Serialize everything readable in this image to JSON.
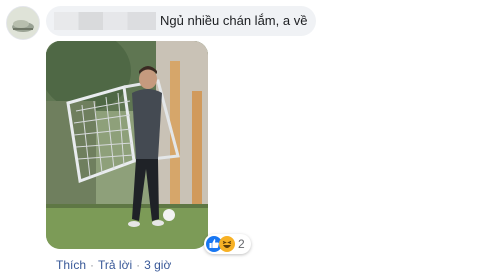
{
  "comment": {
    "author_name": "",
    "text": "Ngủ nhiều chán lắm, a về",
    "reactions": {
      "icons": [
        "like-icon",
        "haha-icon"
      ],
      "count": "2"
    },
    "actions": {
      "like": "Thích",
      "reply": "Trả lời",
      "time": "3 giờ",
      "separator": "·"
    }
  },
  "colors": {
    "bubble": "#f0f2f5",
    "link": "#385898",
    "meta": "#65676b",
    "like_blue": "#1877f2",
    "haha_yellow": "#f7b125"
  }
}
